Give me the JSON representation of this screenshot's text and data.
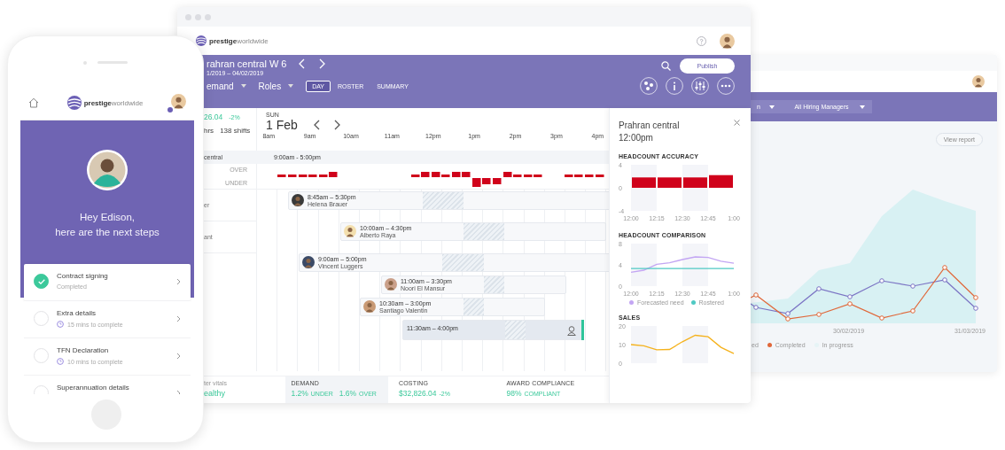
{
  "phone": {
    "brand": "**prestige**worldwide",
    "greeting": [
      "Hey Edison,",
      "here are the next steps"
    ],
    "steps": [
      {
        "title": "Contract signing",
        "subtitle": "Completed",
        "checked": true
      },
      {
        "title": "Extra details",
        "subtitle": "15 mins to complete",
        "checked": false
      },
      {
        "title": "TFN Declaration",
        "subtitle": "10 mins to complete",
        "checked": false
      },
      {
        "title": "Superannuation details",
        "checked": false
      }
    ]
  },
  "main_window": {
    "brand": "**prestige**worldwide",
    "roster": {
      "title": "rahran central W 6",
      "dates": "1/2019 – 04/02/2019",
      "publish": "Publish",
      "filters": [
        "emand",
        "Roles"
      ],
      "views": [
        {
          "label": "DAY",
          "selected": true
        },
        {
          "label": "ROSTER",
          "selected": false
        },
        {
          "label": "SUMMARY",
          "selected": false
        }
      ]
    },
    "summary": {
      "cost": "26.04",
      "cost_change": "-2%",
      "hours": "hrs",
      "shifts": "138 shifts"
    },
    "day": {
      "weekday": "SUN",
      "date": "1 Feb",
      "hours": [
        "8am",
        "9am",
        "10am",
        "11am",
        "12pm",
        "1pm",
        "2pm",
        "3pm",
        "4pm"
      ]
    },
    "location": {
      "name": "central",
      "hours": "9:00am - 5:00pm"
    },
    "demand_labels": [
      "OVER",
      "UNDER"
    ],
    "roles": [
      "er",
      "ant"
    ],
    "shifts": [
      {
        "kind": "assigned",
        "time": "8:45am – 5:30pm",
        "name": "Helena Brauer"
      },
      {
        "kind": "assigned",
        "time": "10:00am – 4:30pm",
        "name": "Alberto Raya"
      },
      {
        "kind": "assigned",
        "time": "9:00am – 5:00pm",
        "name": "Vincent Luggers"
      },
      {
        "kind": "assigned",
        "time": "11:00am – 3:30pm",
        "name": "Noori El Mansur"
      },
      {
        "kind": "assigned",
        "time": "10:30am – 3:00pm",
        "name": "Santiago Valentin"
      },
      {
        "kind": "open",
        "time": "11:30am – 4:00pm"
      }
    ],
    "vitals": {
      "label": "ter vitals",
      "status": "ealthy"
    },
    "metrics": [
      {
        "title": "DEMAND",
        "selected": true,
        "parts": [
          {
            "value": "1.2%",
            "unit": "UNDER"
          },
          {
            "value": "1.6%",
            "unit": "OVER"
          }
        ]
      },
      {
        "title": "COSTING",
        "selected": false,
        "parts": [
          {
            "value": "$32,826.04",
            "unit": "-2%"
          }
        ]
      },
      {
        "title": "AWARD COMPLIANCE",
        "selected": false,
        "parts": [
          {
            "value": "98%",
            "unit": "COMPLIANT"
          }
        ]
      }
    ],
    "panel": {
      "title": "Prahran central",
      "time": "12:00pm",
      "charts": [
        {
          "chart_data": {
            "type": "bar",
            "title": "HEADCOUNT ACCURACY",
            "categories": [
              "12:00",
              null,
              "12:15",
              null,
              "12:30",
              null,
              "12:45",
              null,
              "1:00"
            ],
            "values": [
              null,
              1.8,
              null,
              1.8,
              null,
              1.8,
              null,
              2.2,
              null
            ],
            "ylim": [
              -4,
              4
            ],
            "yticks": [
              4,
              0,
              -4
            ]
          }
        },
        {
          "chart_data": {
            "type": "line",
            "title": "HEADCOUNT COMPARISON",
            "categories": [
              "12:00",
              null,
              "12:15",
              null,
              "12:30",
              null,
              "12:45",
              null,
              "1:00"
            ],
            "ylim": [
              0,
              8
            ],
            "yticks": [
              8,
              4,
              0
            ],
            "legend": true,
            "series": [
              {
                "name": "Forecasted need",
                "color": "#c3a6f3",
                "values": [
                  2.6,
                  3.0,
                  4.1,
                  4.4,
                  5.0,
                  5.5,
                  5.4,
                  4.7,
                  4.3
                ]
              },
              {
                "name": "Rostered",
                "color": "#4fc9c3",
                "values": [
                  3.3,
                  3.3,
                  3.3,
                  3.3,
                  3.3,
                  3.3,
                  3.3,
                  3.3,
                  3.3
                ]
              }
            ]
          }
        },
        {
          "chart_data": {
            "type": "line",
            "title": "SALES",
            "categories": [
              null,
              null,
              null,
              null,
              null,
              null,
              null,
              null,
              null
            ],
            "ylim": [
              0,
              20
            ],
            "yticks": [
              20,
              10,
              0
            ],
            "series": [
              {
                "color": "#f5b21c",
                "values": [
                  10,
                  9.4,
                  7.2,
                  7.4,
                  11.5,
                  15,
                  14.2,
                  8.5,
                  5.2
                ]
              }
            ]
          }
        }
      ]
    }
  },
  "back_window": {
    "filters": [
      "n",
      "All Hiring Managers"
    ],
    "view_report": "View report",
    "x_labels": [
      "30/02/2019",
      "31/03/2019"
    ],
    "legend": [
      {
        "label": "ed"
      },
      {
        "label": "Completed",
        "color": "#e0683a"
      },
      {
        "label": "In progress",
        "color": "#e6f4f6"
      }
    ]
  }
}
